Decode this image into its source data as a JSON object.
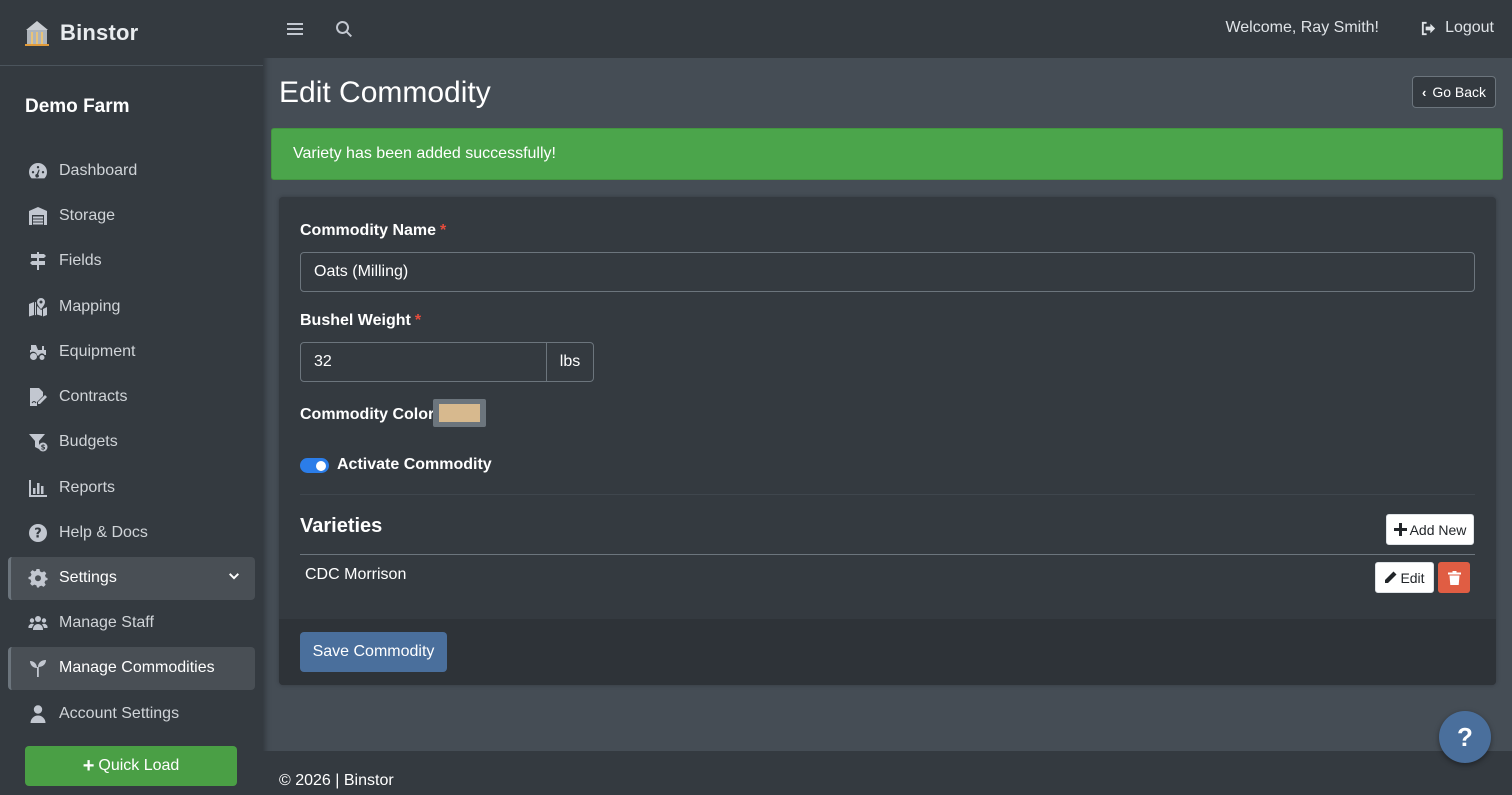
{
  "brand": {
    "name": "Binstor",
    "logo_icon": "grain-bin-icon"
  },
  "sidebar": {
    "farm_name": "Demo Farm",
    "items": [
      {
        "label": "Dashboard",
        "icon": "gauge-icon"
      },
      {
        "label": "Storage",
        "icon": "warehouse-icon"
      },
      {
        "label": "Fields",
        "icon": "signpost-icon"
      },
      {
        "label": "Mapping",
        "icon": "map-location-icon"
      },
      {
        "label": "Equipment",
        "icon": "tractor-icon"
      },
      {
        "label": "Contracts",
        "icon": "file-signature-icon"
      },
      {
        "label": "Budgets",
        "icon": "funnel-dollar-icon"
      },
      {
        "label": "Reports",
        "icon": "bar-chart-icon"
      },
      {
        "label": "Help & Docs",
        "icon": "question-circle-icon"
      },
      {
        "label": "Settings",
        "icon": "gear-icon",
        "expanded": true
      },
      {
        "label": "Manage Staff",
        "icon": "users-icon"
      },
      {
        "label": "Manage Commodities",
        "icon": "seedling-icon",
        "active": true
      },
      {
        "label": "Account Settings",
        "icon": "user-icon"
      }
    ],
    "quick_load": {
      "label": "Quick Load",
      "icon": "plus-icon"
    }
  },
  "topbar": {
    "menu_icon": "hamburger-icon",
    "search_icon": "search-icon",
    "welcome": "Welcome, Ray Smith!",
    "logout": "Logout"
  },
  "page": {
    "title": "Edit Commodity",
    "go_back": "Go Back",
    "alert": "Variety has been added successfully!"
  },
  "form": {
    "commodity_name_label": "Commodity Name",
    "commodity_name_value": "Oats (Milling)",
    "required_marker": "*",
    "bushel_weight_label": "Bushel Weight",
    "bushel_weight_value": "32",
    "bushel_weight_unit": "lbs",
    "color_label": "Commodity Color",
    "color_value": "#d7b98e",
    "activate_label": "Activate Commodity",
    "activate_on": true
  },
  "varieties": {
    "title": "Varieties",
    "add_new": "Add New",
    "rows": [
      {
        "name": "CDC Morrison",
        "edit_label": "Edit"
      }
    ]
  },
  "actions": {
    "save": "Save Commodity"
  },
  "footer": {
    "text": "© 2026 | Binstor"
  },
  "help_fab": {
    "label": "?"
  },
  "colors": {
    "success": "#4ba54b",
    "primary": "#4a6f9c",
    "danger": "#e05d43",
    "sidebar_bg": "#343a40",
    "content_bg": "#454d55"
  }
}
